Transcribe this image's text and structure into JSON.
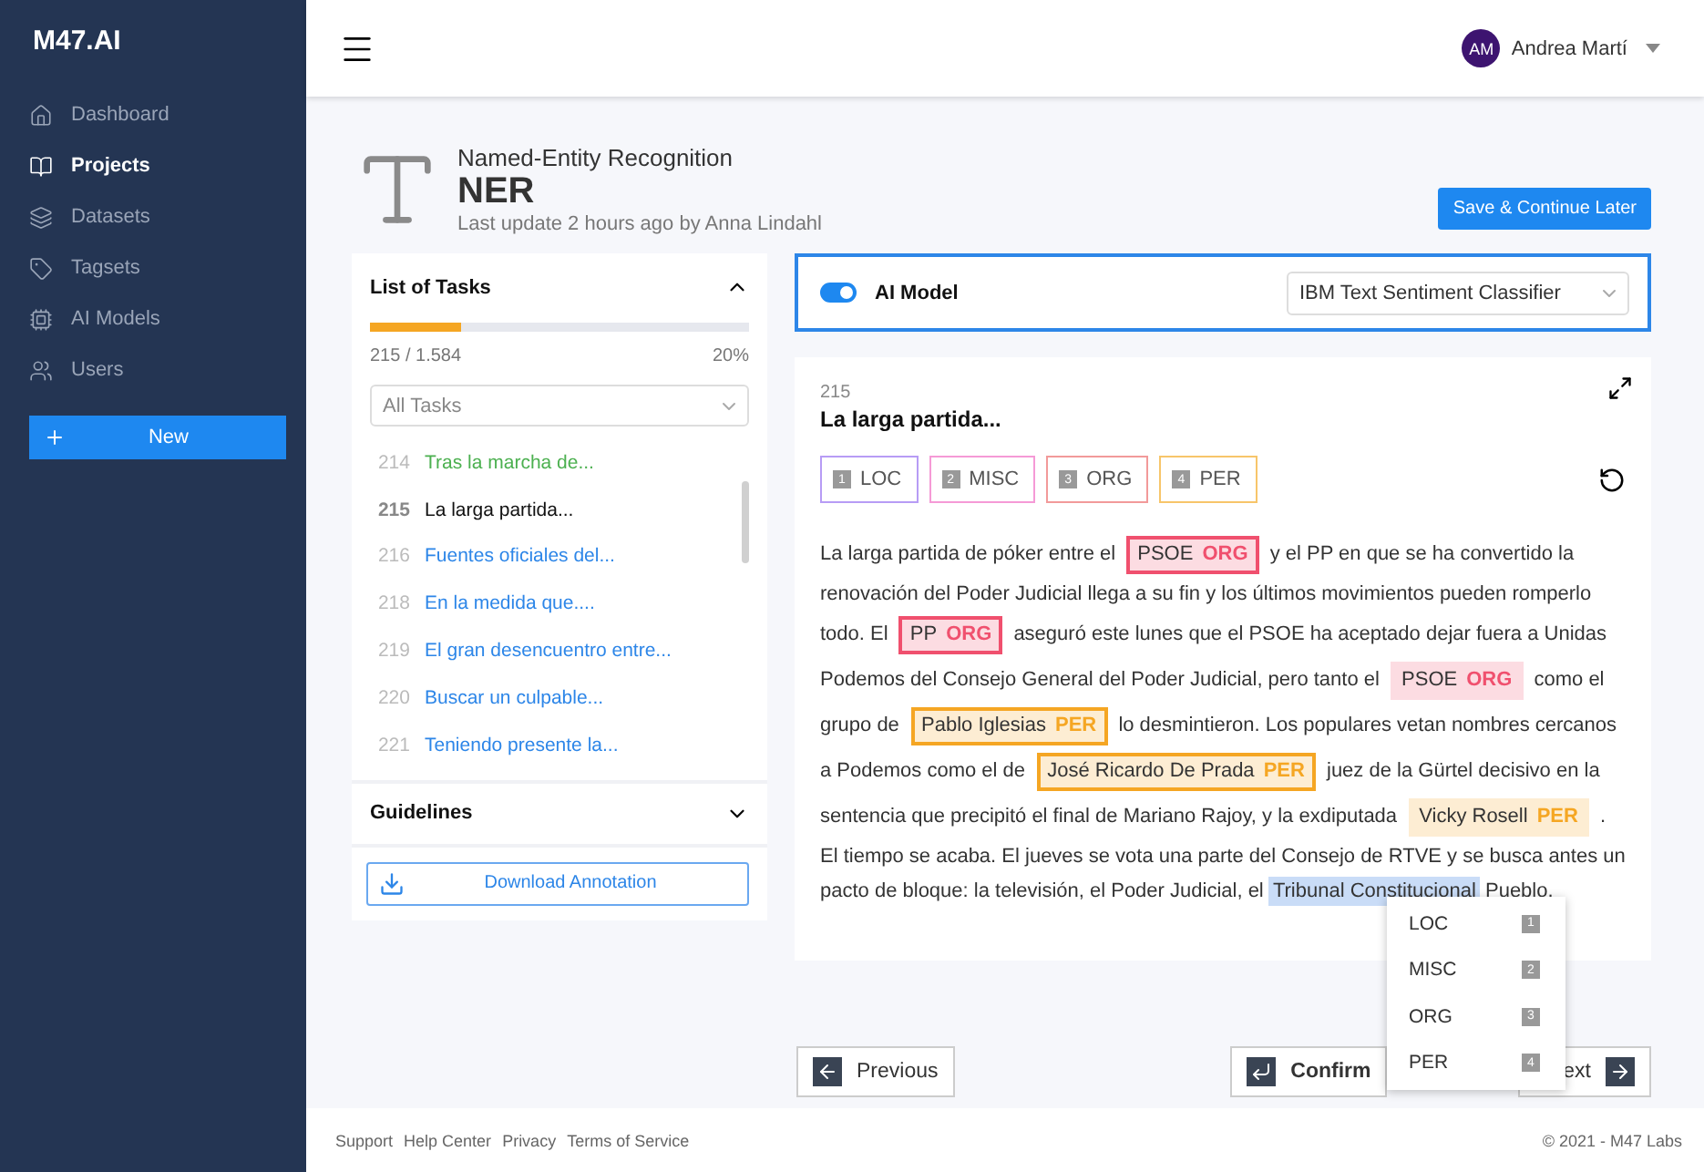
{
  "brand": "M47.AI",
  "sidebar": {
    "items": [
      {
        "label": "Dashboard",
        "selected": false
      },
      {
        "label": "Projects",
        "selected": true
      },
      {
        "label": "Datasets",
        "selected": false
      },
      {
        "label": "Tagsets",
        "selected": false
      },
      {
        "label": "AI Models",
        "selected": false
      },
      {
        "label": "Users",
        "selected": false
      }
    ],
    "new_button": "New"
  },
  "user": {
    "initials": "AM",
    "name": "Andrea Martí"
  },
  "project": {
    "type": "Named-Entity Recognition",
    "name": "NER",
    "updated": "Last update 2 hours ago by Anna Lindahl",
    "save_button": "Save & Continue Later"
  },
  "task_list": {
    "title": "List of Tasks",
    "expanded": true,
    "level": 0.24,
    "count": "215 / 1.584",
    "percent": "20%",
    "filter": "All Tasks",
    "tasks": [
      {
        "number": "214",
        "title": "Tras la marcha de...",
        "done": true,
        "selected": false
      },
      {
        "number": "215",
        "title": "La larga partida...",
        "done": false,
        "selected": true
      },
      {
        "number": "216",
        "title": "Fuentes oficiales del...",
        "done": false,
        "selected": false
      },
      {
        "number": "218",
        "title": "En la medida que....",
        "done": false,
        "selected": false
      },
      {
        "number": "219",
        "title": "El gran desencuentro entre...",
        "done": false,
        "selected": false
      },
      {
        "number": "220",
        "title": "Buscar un culpable...",
        "done": false,
        "selected": false
      },
      {
        "number": "221",
        "title": "Teniendo presente la...",
        "done": false,
        "selected": false
      }
    ]
  },
  "guidelines": {
    "title": "Guidelines",
    "expanded": false
  },
  "download_button": "Download Annotation",
  "ai_model": {
    "label": "AI Model",
    "on": true,
    "model": "IBM Text Sentiment Classifier"
  },
  "document": {
    "number": "215",
    "title": "La larga partida...",
    "tags": [
      {
        "key": "1",
        "label": "LOC",
        "color": "#b79cf5"
      },
      {
        "key": "2",
        "label": "MISC",
        "color": "#f59ad6"
      },
      {
        "key": "3",
        "label": "ORG",
        "color": "#f29a9a"
      },
      {
        "key": "4",
        "label": "PER",
        "color": "#f7c56a"
      }
    ],
    "passage": [
      {
        "kind": "text",
        "text": "La larga partida de póker entre el"
      },
      {
        "kind": "entity",
        "text": "PSOE",
        "label": "ORG",
        "color": "#f0506e",
        "confirmed": true
      },
      {
        "kind": "text",
        "text": "y el PP en que se ha convertido la renovación del Poder Judicial llega a su fin y los últimos movimientos pueden romperlo todo. El"
      },
      {
        "kind": "entity",
        "text": "PP",
        "label": "ORG",
        "color": "#f0506e",
        "confirmed": true
      },
      {
        "kind": "text",
        "text": "aseguró este lunes que el PSOE ha aceptado dejar fuera a Unidas Podemos del Consejo General del Poder Judicial, pero tanto el"
      },
      {
        "kind": "entity",
        "text": "PSOE",
        "label": "ORG",
        "color": "#f0506e",
        "confirmed": false
      },
      {
        "kind": "text",
        "text": "como el grupo de"
      },
      {
        "kind": "entity",
        "text": "Pablo Iglesias",
        "label": "PER",
        "color": "#f5a623",
        "confirmed": true
      },
      {
        "kind": "text",
        "text": "lo desmintieron. Los populares vetan nombres cercanos a Podemos como el de"
      },
      {
        "kind": "entity",
        "text": "José Ricardo De Prada",
        "label": "PER",
        "color": "#f5a623",
        "confirmed": true
      },
      {
        "kind": "text",
        "text": "juez de la Gürtel decisivo en la sentencia que precipitó el final de Mariano Rajoy, y la exdiputada"
      },
      {
        "kind": "entity",
        "text": "Vicky Rosell",
        "label": "PER",
        "color": "#f5a623",
        "confirmed": false
      },
      {
        "kind": "text",
        "text": ". El tiempo se acaba. El jueves se vota una parte del Consejo de RTVE y se busca antes un pacto de bloque: la televisión, el Poder Judicial, el"
      },
      {
        "kind": "selection",
        "text": "Tribunal Constitucional"
      },
      {
        "kind": "text",
        "text": "Pueblo."
      }
    ]
  },
  "context_menu": [
    {
      "label": "LOC",
      "key": "1"
    },
    {
      "label": "MISC",
      "key": "2"
    },
    {
      "label": "ORG",
      "key": "3"
    },
    {
      "label": "PER",
      "key": "4"
    }
  ],
  "nav": {
    "previous": "Previous",
    "confirm": "Confirm",
    "next": "ext"
  },
  "footer": {
    "links": [
      "Support",
      "Help Center",
      "Privacy",
      "Terms of Service"
    ],
    "copyright": "© 2021 - M47 Labs"
  }
}
